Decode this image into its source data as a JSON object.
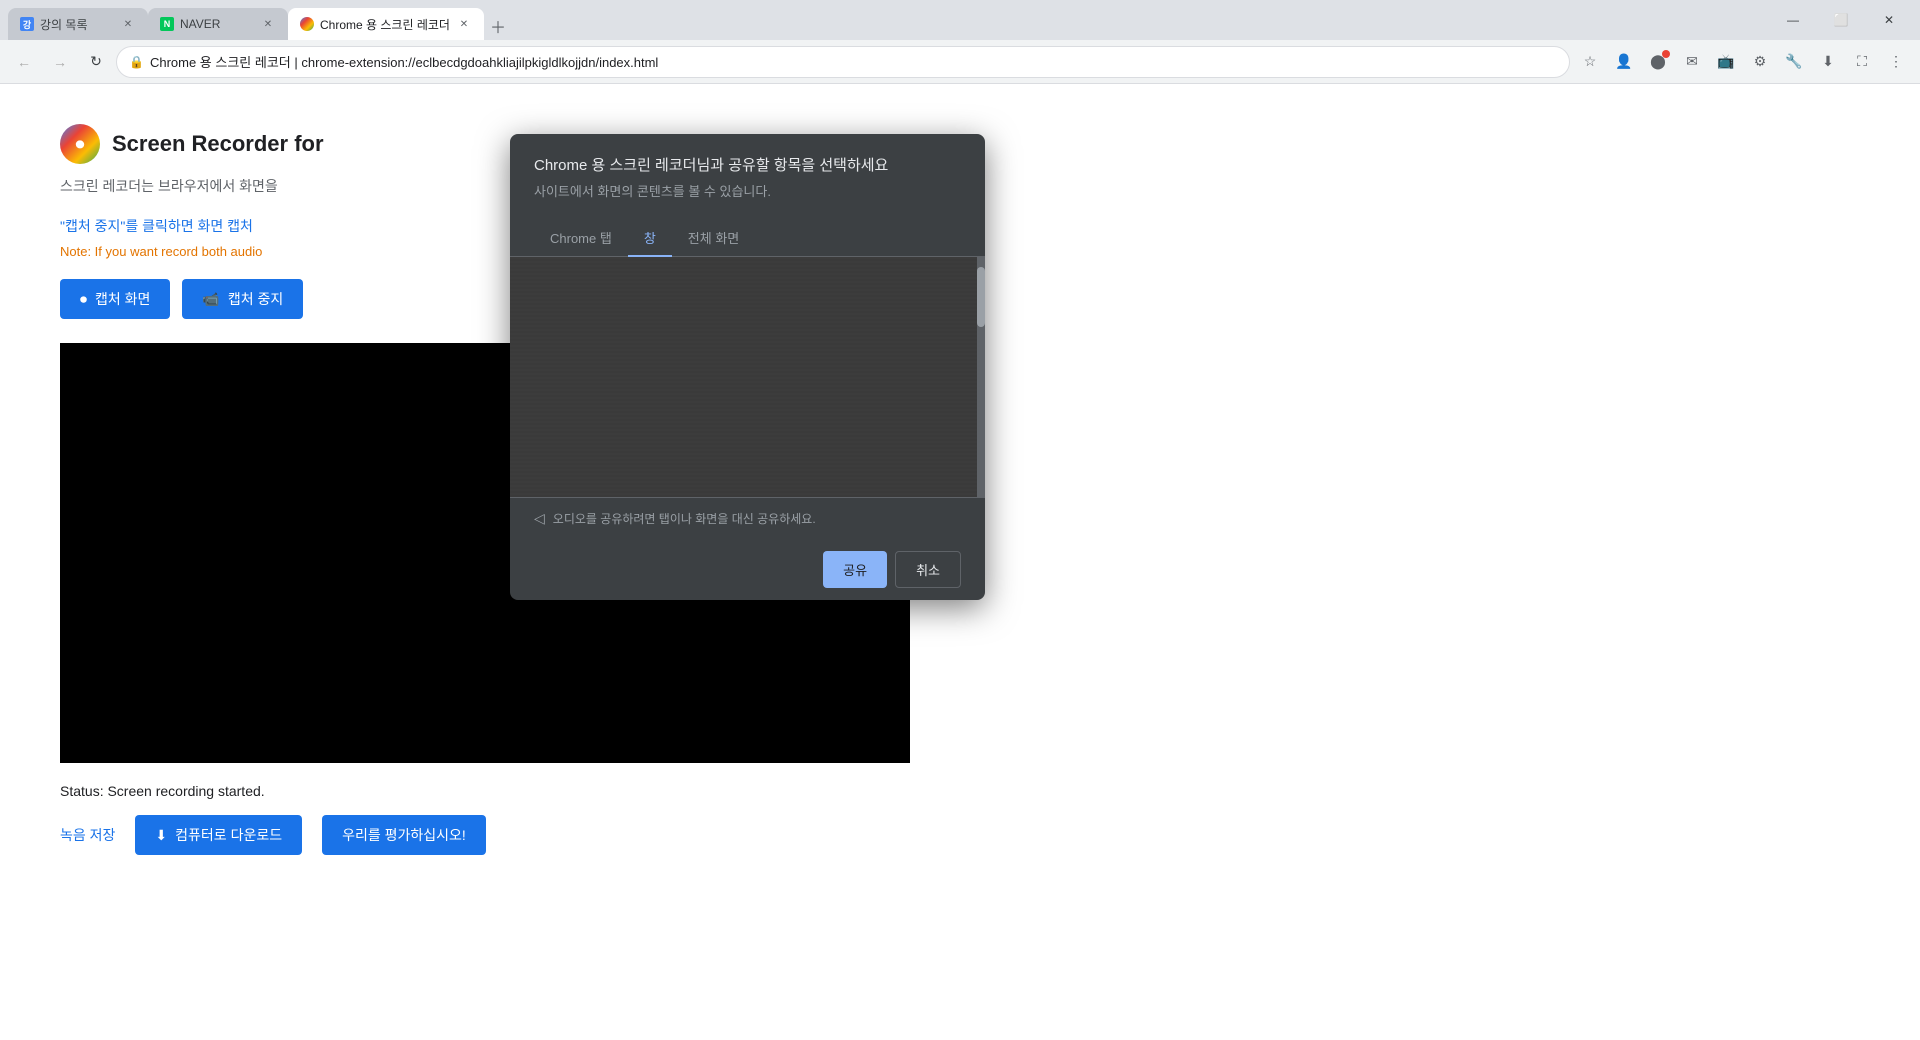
{
  "browser": {
    "tabs": [
      {
        "id": "tab-1",
        "title": "강의 목록",
        "favicon_color": "#4444cc",
        "favicon_text": "강",
        "active": false
      },
      {
        "id": "tab-2",
        "title": "NAVER",
        "favicon_color": "#03c75a",
        "favicon_text": "N",
        "active": false
      },
      {
        "id": "tab-3",
        "title": "Chrome 용 스크린 레코더",
        "favicon_color": "#4285f4",
        "favicon_text": "●",
        "active": true
      }
    ],
    "address": "chrome-extension://eclbecdgdoahkliajilpkigldlkojjdn/index.html",
    "address_display": "Chrome 용 스크린 레코더 | chrome-extension://eclbecdgdoahkliajilpkigldlkojjdn/index.html"
  },
  "page": {
    "app_title": "Screen Recorder for",
    "app_subtitle": "스크린 레코더는 브라우저에서 화면을",
    "instructions": "\"캡처 중지\"를 클릭하면 화면 캡처",
    "note": "Note: If you want record both audio",
    "btn_capture": "캡처 화면",
    "btn_stop": "캡처 중지",
    "status": "Status: Screen recording started.",
    "save_link": "녹음 저장",
    "btn_download": "컴퓨터로 다운로드",
    "btn_rate": "우리를 평가하십시오!"
  },
  "dialog": {
    "title": "Chrome 용 스크린 레코더님과 공유할 항목을 선택하세요",
    "subtitle": "사이트에서 화면의 콘텐츠를 볼 수 있습니다.",
    "tabs": [
      {
        "id": "chrome-tab",
        "label": "Chrome 탭",
        "active": false
      },
      {
        "id": "window-tab",
        "label": "창",
        "active": true
      },
      {
        "id": "fullscreen-tab",
        "label": "전체 화면",
        "active": false
      }
    ],
    "audio_note": "오디오를 공유하려면 탭이나 화면을 대신 공유하세요.",
    "btn_share": "공유",
    "btn_cancel": "취소"
  }
}
